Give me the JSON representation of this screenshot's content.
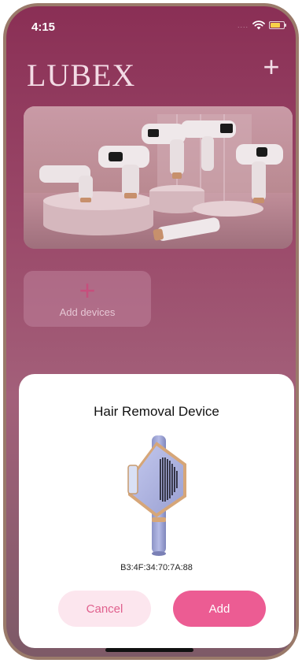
{
  "status_bar": {
    "time": "4:15",
    "signal": "....",
    "wifi_icon": "wifi-icon",
    "battery_icon": "battery-icon",
    "battery_color": "#f7d24a",
    "battery_level": 0.75
  },
  "header": {
    "brand": "LUBEX",
    "add_icon": "plus-icon"
  },
  "banner": {
    "image": "product-lineup-photo"
  },
  "add_devices": {
    "icon": "plus-icon",
    "label": "Add devices"
  },
  "modal": {
    "title": "Hair Removal Device",
    "device_image": "hair-removal-device-illustration",
    "mac_address": "B3:4F:34:70:7A:88",
    "cancel_label": "Cancel",
    "add_label": "Add"
  },
  "colors": {
    "accent": "#ec5c93",
    "accent_light": "#fce6ee",
    "brand_text": "#f3dbe5"
  }
}
